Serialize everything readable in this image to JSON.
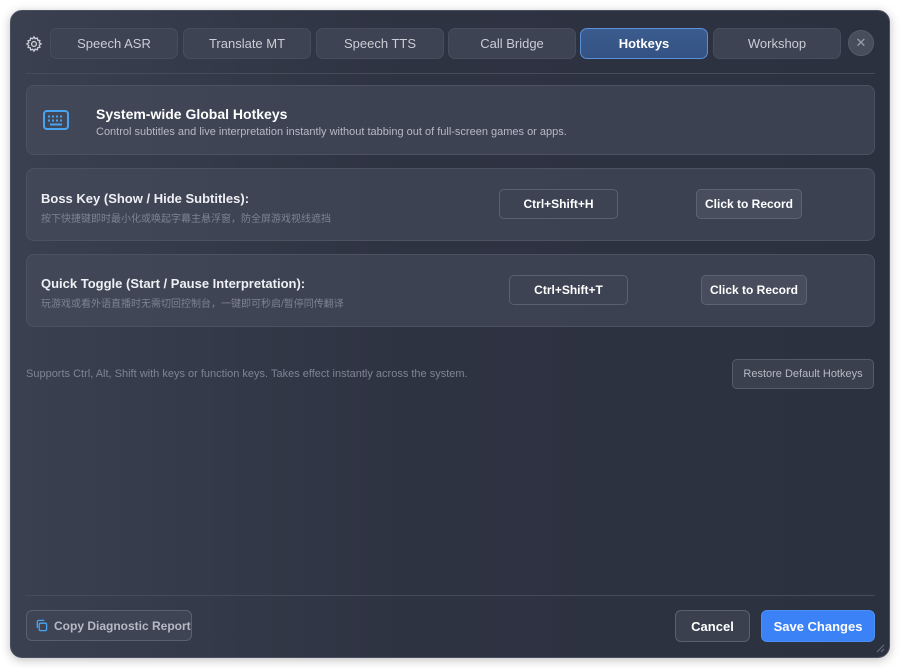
{
  "colors": {
    "accent": "#3b82f6",
    "active_tab": "#345283",
    "icon_blue": "#4aa3f0"
  },
  "header": {
    "settings_icon": "gear-icon",
    "close_icon": "close-icon",
    "close_symbol": "✕",
    "tabs": [
      {
        "label": "Speech ASR",
        "active": false
      },
      {
        "label": "Translate MT",
        "active": false
      },
      {
        "label": "Speech TTS",
        "active": false
      },
      {
        "label": "Call Bridge",
        "active": false
      },
      {
        "label": "Hotkeys",
        "active": true
      },
      {
        "label": "Workshop",
        "active": false
      }
    ]
  },
  "info": {
    "icon": "keyboard-icon",
    "title": "System-wide Global Hotkeys",
    "subtitle": "Control subtitles and live interpretation instantly without tabbing out of full-screen games or apps."
  },
  "hotkeys": [
    {
      "title": "Boss Key (Show / Hide Subtitles):",
      "description": "按下快捷键即时最小化或唤起字幕主悬浮窗，防全屏游戏视线遮挡",
      "combo": "Ctrl+Shift+H",
      "record_label": "Click to Record"
    },
    {
      "title": "Quick Toggle (Start / Pause Interpretation):",
      "description": "玩游戏或看外语直播时无需切回控制台，一键即可秒启/暂停同传翻译",
      "combo": "Ctrl+Shift+T",
      "record_label": "Click to Record"
    }
  ],
  "footnote": "Supports Ctrl, Alt, Shift with keys or function keys. Takes effect instantly across the system.",
  "restore_label": "Restore Default Hotkeys",
  "footer": {
    "diagnostic_label": "Copy Diagnostic Report",
    "diagnostic_icon": "copy-icon",
    "cancel_label": "Cancel",
    "save_label": "Save Changes"
  }
}
